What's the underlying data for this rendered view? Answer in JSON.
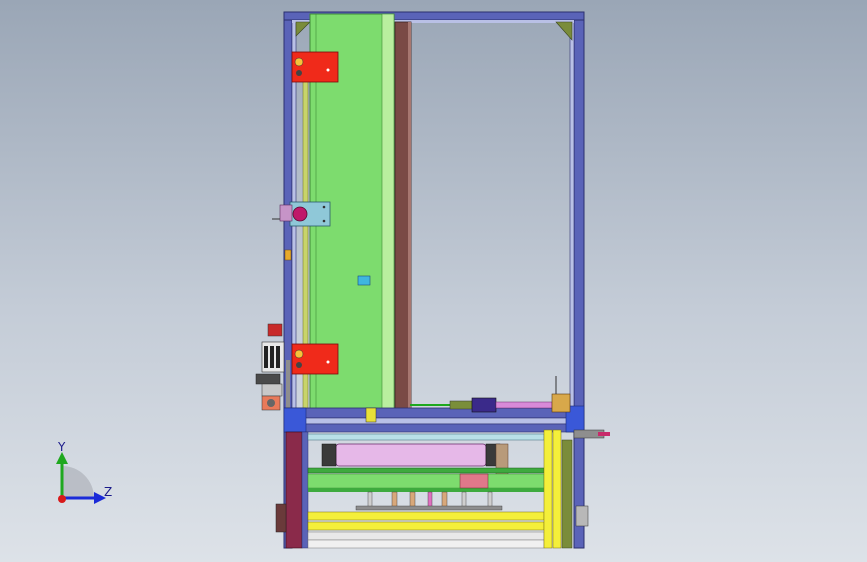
{
  "view": {
    "background_top": "#9aa6b6",
    "background_bottom": "#dde2e8"
  },
  "colors": {
    "frame_blue": "#5a63b8",
    "frame_dark": "#2b2f6e",
    "frame_light": "#b9c0e6",
    "green_panel": "#7ddc6e",
    "green_edge": "#3e8a36",
    "brown_belt": "#7a4a45",
    "red_bracket": "#f02a1a",
    "cyan_bracket": "#8fc8d8",
    "magenta_knob": "#c0186a",
    "yellow_beam": "#f4ef3a",
    "pink_roller": "#e6b8e8",
    "gray_detail": "#8e8e8e",
    "orange_accent": "#e8782a"
  },
  "triad": {
    "y_label": "Y",
    "z_label": "Z",
    "y_color": "#1fa81f",
    "z_color": "#1a2ad8",
    "x_color": "#d81a1a"
  }
}
